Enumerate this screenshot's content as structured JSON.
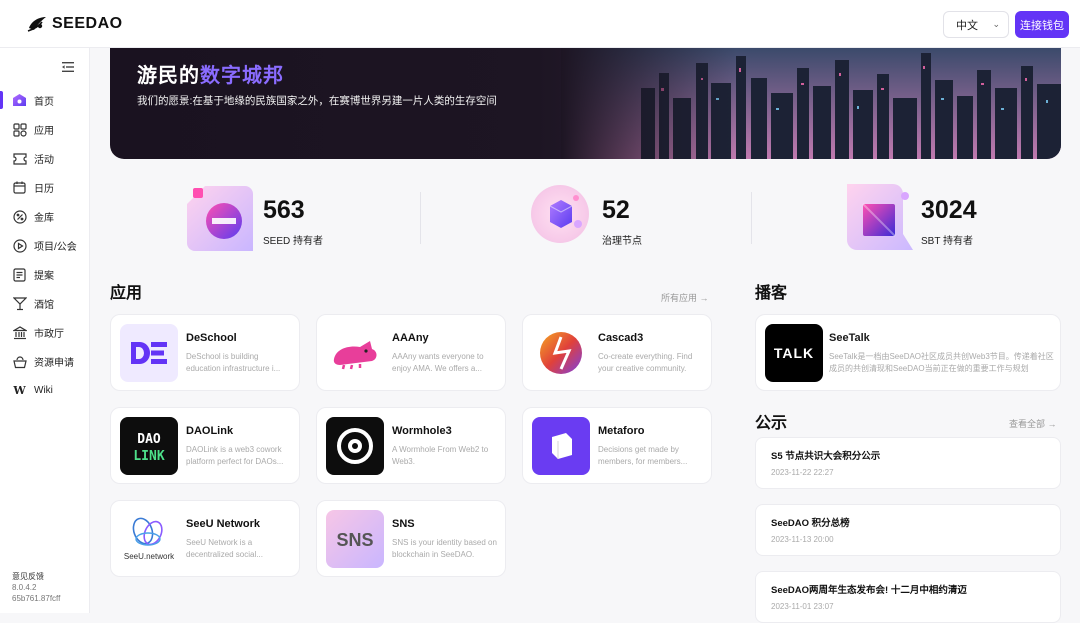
{
  "header": {
    "logo_text": "SEEDAO",
    "language": "中文",
    "connect_wallet": "连接钱包"
  },
  "sidebar": {
    "items": [
      {
        "label": "首页",
        "icon": "home-icon",
        "active": true
      },
      {
        "label": "应用",
        "icon": "apps-grid-icon"
      },
      {
        "label": "活动",
        "icon": "ticket-icon"
      },
      {
        "label": "日历",
        "icon": "calendar-icon"
      },
      {
        "label": "金库",
        "icon": "percent-coin-icon"
      },
      {
        "label": "项目/公会",
        "icon": "play-circle-icon"
      },
      {
        "label": "提案",
        "icon": "document-icon"
      },
      {
        "label": "酒馆",
        "icon": "cocktail-glass-icon"
      },
      {
        "label": "市政厅",
        "icon": "bank-building-icon"
      },
      {
        "label": "资源申请",
        "icon": "basket-icon"
      },
      {
        "label": "Wiki",
        "icon": "wiki-w-icon"
      }
    ],
    "feedback": "意见反馈",
    "version": "8.0.4.2",
    "commit": "65b761.87fcff"
  },
  "banner": {
    "title_prefix": "游民的",
    "title_highlight": "数字城邦",
    "subtitle": "我们的愿景:在基于地缘的民族国家之外，在赛博世界另建一片人类的生存空间"
  },
  "stats": [
    {
      "value": "563",
      "label": "SEED 持有者"
    },
    {
      "value": "52",
      "label": "治理节点"
    },
    {
      "value": "3024",
      "label": "SBT 持有者"
    }
  ],
  "apps_section": {
    "title": "应用",
    "all_link": "所有应用 →",
    "apps": [
      {
        "name": "DeSchool",
        "desc": "DeSchool is building education infrastructure i..."
      },
      {
        "name": "AAAny",
        "desc": "AAAny wants everyone to enjoy AMA. We offers a..."
      },
      {
        "name": "Cascad3",
        "desc": "Co-create everything. Find your creative community."
      },
      {
        "name": "DAOLink",
        "desc": "DAOLink is a web3 cowork platform perfect for DAOs..."
      },
      {
        "name": "Wormhole3",
        "desc": "A Wormhole From Web2 to Web3."
      },
      {
        "name": "Metaforo",
        "desc": "Decisions get made by members, for members..."
      },
      {
        "name": "SeeU Network",
        "desc": "SeeU Network is a decentralized social..."
      },
      {
        "name": "SNS",
        "desc": "SNS is your identity based on blockchain in SeeDAO."
      }
    ]
  },
  "podcast_section": {
    "title": "播客",
    "item": {
      "name": "SeeTalk",
      "icon_text": "TALK",
      "desc": "SeeTalk是一档由SeeDAO社区成员共创Web3节目。传递着社区成员的共创清现和SeeDAO当前正在做的重要工作与规划"
    }
  },
  "notice_section": {
    "title": "公示",
    "view_all": "查看全部 →",
    "items": [
      {
        "title": "S5 节点共识大会积分公示",
        "date": "2023-11-22 22:27"
      },
      {
        "title": "SeeDAO 积分总榜",
        "date": "2023-11-13 20:00"
      },
      {
        "title": "SeeDAO两周年生态发布会! 十二月中相约清迈",
        "date": "2023-11-01 23:07"
      }
    ]
  },
  "colors": {
    "accent": "#6334f6",
    "highlight": "#8a6cff"
  }
}
